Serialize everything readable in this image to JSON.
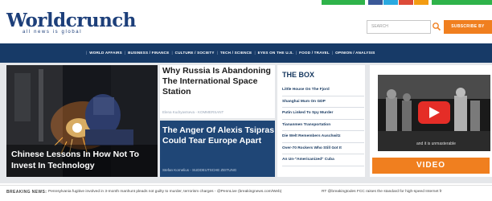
{
  "brand": {
    "name": "Worldcrunch",
    "tagline": "all news is global"
  },
  "header": {
    "search_placeholder": "SEARCH",
    "subscribe_label": "SUBSCRIBE BY EMAIL"
  },
  "colors": {
    "nav_bg": "#173a67",
    "accent_orange": "#f07f1f",
    "brand_blue": "#1d3f7a",
    "social_green": "#2fb34a",
    "facebook": "#3b5998",
    "twitter": "#2aa9e0",
    "googleplus": "#dd4b39",
    "rss": "#f39c12"
  },
  "social": {
    "icons": [
      "facebook-icon",
      "twitter-icon",
      "google-plus-icon",
      "rss-icon"
    ]
  },
  "nav": {
    "items": [
      "WORLD AFFAIRS",
      "BUSINESS / FINANCE",
      "CULTURE / SOCIETY",
      "TECH / SCIENCE",
      "EYES ON THE U.S.",
      "FOOD / TRAVEL",
      "OPINION / ANALYSIS"
    ]
  },
  "hero": {
    "title": "Chinese Lessons In How Not To Invest In Technology"
  },
  "articles": [
    {
      "title": "Why Russia Is Abandoning The International Space Station",
      "byline": "Elena Kudryavtseva - KOMMERSANT"
    },
    {
      "title": "The Anger Of Alexis Tsipras Could Tear Europe Apart",
      "byline": "Stefan Kornelius - SUDDEUTSCHE ZEITUNG"
    }
  ],
  "the_box": {
    "title": "THE BOX",
    "items": [
      "Little House On The Fjord",
      "Shanghai Mum On GDP",
      "Putin Linked To Spy Murder",
      "Tiananmen Transportation",
      "Die Welt Remembers Auschwitz",
      "Over-70 Rockers Who Still Got It",
      "An Un-\"Americanized\" Cuba"
    ]
  },
  "video": {
    "subtitle": "and it is unmasterable",
    "button_label": "VIDEO"
  },
  "ticker": {
    "label": "BREAKING NEWS:",
    "text_1": "Pennsylvania fugitive involved in 3-month manhunt pleads not guilty to murder, terrorism charges - @PennLive (breakingnews.com/Web)",
    "text_2": "RT @breakingtodes FCC raises the standard for high-speed Internet fr"
  }
}
